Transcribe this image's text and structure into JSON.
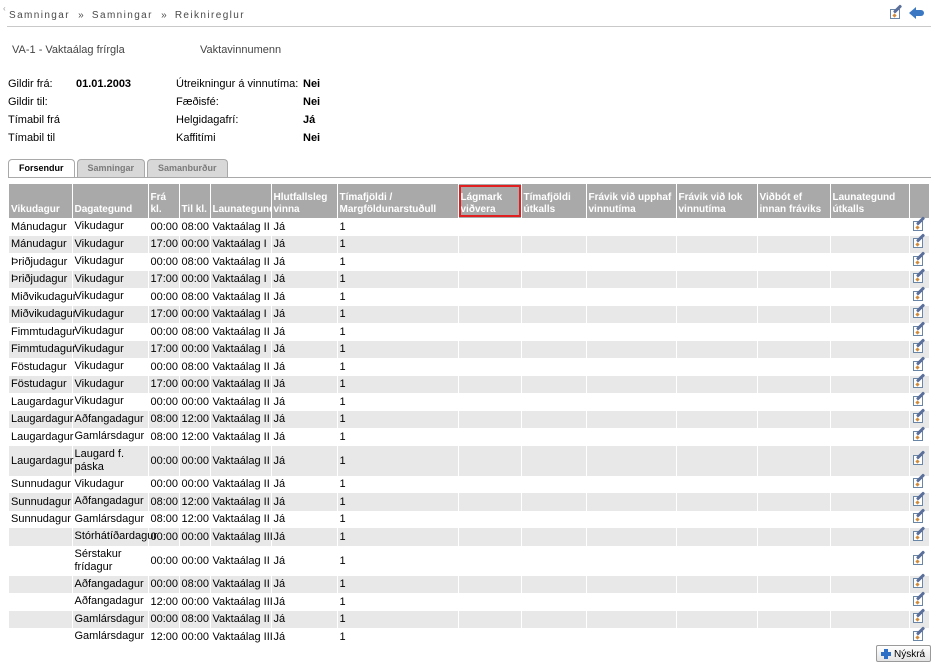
{
  "breadcrumb": [
    "Samningar",
    "Samningar",
    "Reiknireglur"
  ],
  "breadcrumb_sep": "»",
  "rule": {
    "name": "VA-1 - Vaktaálag frírgla",
    "group": "Vaktavinnumenn"
  },
  "info": {
    "col1": [
      {
        "label": "Gildir frá:",
        "value": "01.01.2003"
      },
      {
        "label": "Gildir til:",
        "value": ""
      },
      {
        "label": "Tímabil frá",
        "value": ""
      },
      {
        "label": "Tímabil til",
        "value": ""
      }
    ],
    "col2": [
      {
        "label": "Útreikningur á vinnutíma:",
        "value": "Nei"
      },
      {
        "label": "Fæðisfé:",
        "value": "Nei"
      },
      {
        "label": "Helgidagafrí:",
        "value": "Já"
      },
      {
        "label": "Kaffitími",
        "value": "Nei"
      }
    ]
  },
  "tabs": [
    "Forsendur",
    "Samningar",
    "Samanburður"
  ],
  "active_tab": "Forsendur",
  "table": {
    "headers": [
      "Vikudagur",
      "Dagategund",
      "Frá kl.",
      "Til kl.",
      "Launategund",
      "Hlutfallsleg vinna",
      "Tímafjöldi / Margföldunarstuðull",
      "Lágmark viðvera",
      "Tímafjöldi útkalls",
      "Frávik við upphaf vinnutíma",
      "Frávik við lok vinnutíma",
      "Viðbót ef innan fráviks",
      "Launategund útkalls",
      ""
    ],
    "highlighted_header": "Lágmark viðvera",
    "rows": [
      [
        "Mánudagur",
        "Vikudagur",
        "00:00",
        "08:00",
        "Vaktaálag II",
        "Já",
        "1"
      ],
      [
        "Mánudagur",
        "Vikudagur",
        "17:00",
        "00:00",
        "Vaktaálag I",
        "Já",
        "1"
      ],
      [
        "Þriðjudagur",
        "Vikudagur",
        "00:00",
        "08:00",
        "Vaktaálag II",
        "Já",
        "1"
      ],
      [
        "Þriðjudagur",
        "Vikudagur",
        "17:00",
        "00:00",
        "Vaktaálag I",
        "Já",
        "1"
      ],
      [
        "Miðvikudagur",
        "Vikudagur",
        "00:00",
        "08:00",
        "Vaktaálag II",
        "Já",
        "1"
      ],
      [
        "Miðvikudagur",
        "Vikudagur",
        "17:00",
        "00:00",
        "Vaktaálag I",
        "Já",
        "1"
      ],
      [
        "Fimmtudagur",
        "Vikudagur",
        "00:00",
        "08:00",
        "Vaktaálag II",
        "Já",
        "1"
      ],
      [
        "Fimmtudagur",
        "Vikudagur",
        "17:00",
        "00:00",
        "Vaktaálag I",
        "Já",
        "1"
      ],
      [
        "Föstudagur",
        "Vikudagur",
        "00:00",
        "08:00",
        "Vaktaálag II",
        "Já",
        "1"
      ],
      [
        "Föstudagur",
        "Vikudagur",
        "17:00",
        "00:00",
        "Vaktaálag II",
        "Já",
        "1"
      ],
      [
        "Laugardagur",
        "Vikudagur",
        "00:00",
        "00:00",
        "Vaktaálag II",
        "Já",
        "1"
      ],
      [
        "Laugardagur",
        "Aðfangadagur",
        "08:00",
        "12:00",
        "Vaktaálag II",
        "Já",
        "1"
      ],
      [
        "Laugardagur",
        "Gamlársdagur",
        "08:00",
        "12:00",
        "Vaktaálag II",
        "Já",
        "1"
      ],
      [
        "Laugardagur",
        "Laugard f. páska",
        "00:00",
        "00:00",
        "Vaktaálag II",
        "Já",
        "1"
      ],
      [
        "Sunnudagur",
        "Vikudagur",
        "00:00",
        "00:00",
        "Vaktaálag II",
        "Já",
        "1"
      ],
      [
        "Sunnudagur",
        "Aðfangadagur",
        "08:00",
        "12:00",
        "Vaktaálag II",
        "Já",
        "1"
      ],
      [
        "Sunnudagur",
        "Gamlársdagur",
        "08:00",
        "12:00",
        "Vaktaálag II",
        "Já",
        "1"
      ],
      [
        "",
        "Stórhátíðardagur",
        "00:00",
        "00:00",
        "Vaktaálag III",
        "Já",
        "1"
      ],
      [
        "",
        "Sérstakur frídagur",
        "00:00",
        "00:00",
        "Vaktaálag II",
        "Já",
        "1"
      ],
      [
        "",
        "Aðfangadagur",
        "00:00",
        "08:00",
        "Vaktaálag II",
        "Já",
        "1"
      ],
      [
        "",
        "Aðfangadagur",
        "12:00",
        "00:00",
        "Vaktaálag III",
        "Já",
        "1"
      ],
      [
        "",
        "Gamlársdagur",
        "00:00",
        "08:00",
        "Vaktaálag II",
        "Já",
        "1"
      ],
      [
        "",
        "Gamlársdagur",
        "12:00",
        "00:00",
        "Vaktaálag III",
        "Já",
        "1"
      ]
    ]
  },
  "new_button": "Nýskrá",
  "icons": {
    "edit": "edit-icon",
    "back": "back-arrow-icon",
    "add": "plus-icon"
  },
  "colors": {
    "header_bg": "#a9a9a9",
    "row_alt": "#e8e8e8",
    "highlight": "#e02020",
    "accent": "#2d6fc4"
  }
}
